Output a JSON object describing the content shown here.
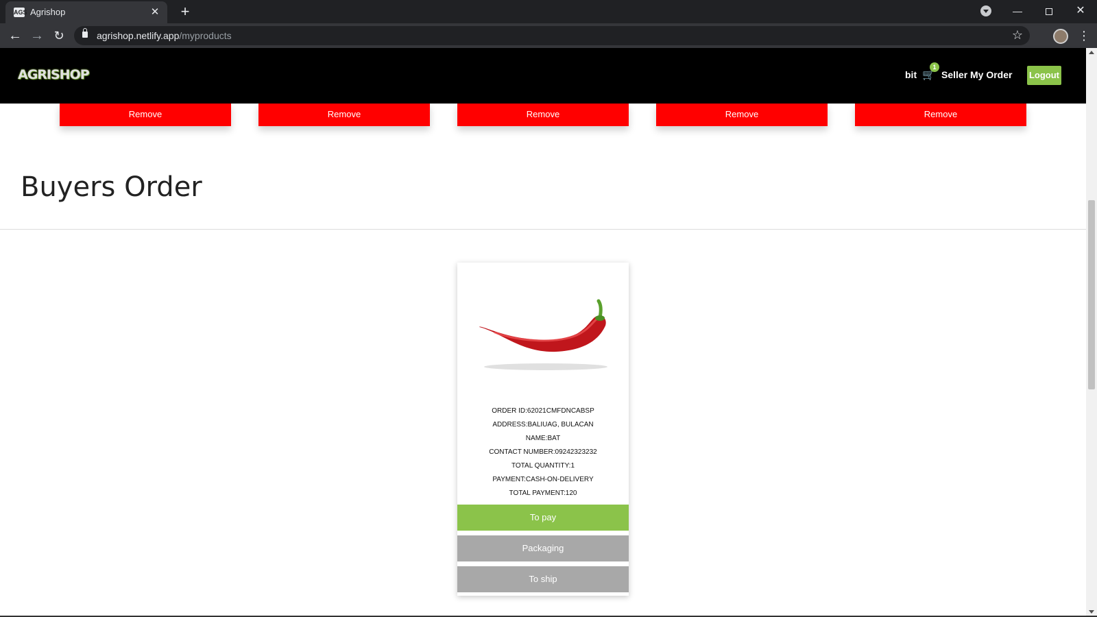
{
  "browser": {
    "tab_favicon_text": "AGS",
    "tab_title": "Agrishop",
    "tab_close": "✕",
    "new_tab": "+",
    "url_domain": "agrishop.netlify.app",
    "url_path": "/myproducts",
    "win_min": "—",
    "win_close": "✕",
    "nav_back": "←",
    "nav_forward": "→",
    "nav_reload": "↻",
    "bookmark_star": "☆",
    "menu_dots": "⋮"
  },
  "header": {
    "logo_text": "AGRISHOP",
    "user_name": "bit",
    "cart_icon": "🛒",
    "cart_count": "1",
    "seller_label": "Seller",
    "my_order_label": "My Order",
    "logout_label": "Logout"
  },
  "products": {
    "remove_buttons": [
      "Remove",
      "Remove",
      "Remove",
      "Remove",
      "Remove"
    ]
  },
  "buyers_order": {
    "title": "Buyers Order",
    "order": {
      "order_id": "ORDER ID:62021CMFDNCABSP",
      "address": "ADDRESS:BALIUAG, BULACAN",
      "name": "NAME:BAT",
      "contact": "CONTACT NUMBER:09242323232",
      "quantity": "TOTAL QUANTITY:1",
      "payment": "PAYMENT:CASH-ON-DELIVERY",
      "total_payment": "TOTAL PAYMENT:120"
    },
    "status_buttons": {
      "to_pay": "To pay",
      "packaging": "Packaging",
      "to_ship": "To ship"
    }
  },
  "colors": {
    "accent_green": "#8bc34a",
    "remove_red": "#ff0000",
    "inactive_gray": "#a8a8a8",
    "header_bg": "#000000"
  }
}
